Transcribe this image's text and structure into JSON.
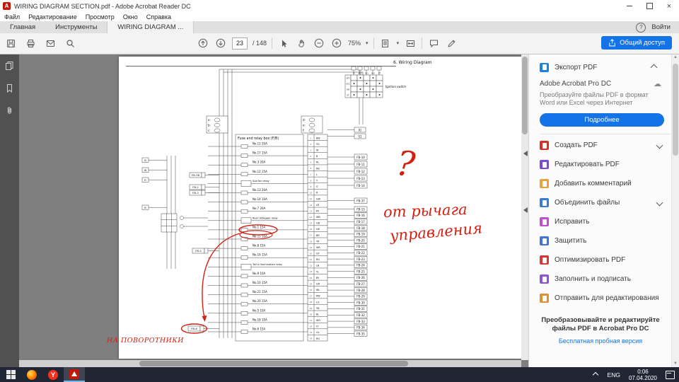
{
  "window": {
    "title": "WIRING DIAGRAM SECTION.pdf - Adobe Acrobat Reader DC"
  },
  "menu": {
    "items": [
      "Файл",
      "Редактирование",
      "Просмотр",
      "Окно",
      "Справка"
    ]
  },
  "tabs": {
    "home": "Главная",
    "tools": "Инструменты",
    "document": "WIRING DIAGRAM ...",
    "help": "?",
    "sign_in": "Войти"
  },
  "toolbar": {
    "page_current": "23",
    "page_total": "/ 148",
    "zoom": "75%",
    "share_label": "Общий доступ"
  },
  "sidebar": {
    "icons": [
      "page-thumbnails-icon",
      "bookmarks-icon",
      "attachments-icon"
    ]
  },
  "document": {
    "diagram": {
      "header": "6. Wiring Diagram",
      "fuse_box_label": "Fuse and relay box (F/B)",
      "ignition_label": "Ignition switch",
      "ignition_cols": [
        "B",
        "ACC",
        "IG1",
        "IG2",
        "ST"
      ],
      "ignition_rows": [
        "OFF",
        "ACC",
        "ON",
        "ST"
      ],
      "fuses": [
        "No.11 20A",
        "No.17 15A",
        "No.3 20A",
        "No.12 15A",
        "Sub fan relay",
        "No.13 20A",
        "No.14 10A",
        "No.7 20A",
        "Rear defogger relay",
        "No.1 15A",
        "No.15 10A",
        "No.8 15A",
        "No.16 15A",
        "Tail & illumination relay",
        "No.9 10A",
        "No.10 15A",
        "No.21 15A",
        "No.20 15A",
        "No.5 10A",
        "No.18 10A",
        "No.6 15A"
      ],
      "left_connectors": [
        "FB-38",
        "FB-2",
        "FB-3",
        "FB-4",
        "FB-6"
      ],
      "right_connectors_top": [
        "FB-10",
        "FB-11",
        "FB-12",
        "FB-13",
        "FB-14"
      ],
      "right_connectors": [
        "FB-37",
        "FB-15",
        "FB-16",
        "FB-17",
        "FB-18",
        "FB-19",
        "FB-20",
        "FB-21",
        "FB-22",
        "FB-23",
        "FB-24",
        "FB-25",
        "FB-26",
        "FB-27",
        "FB-28",
        "FB-29",
        "FB-30",
        "FB-31",
        "FB-32",
        "FB-33",
        "FB-34",
        "FB-35"
      ],
      "top_pins": [
        "IG",
        "S1"
      ],
      "wire_codes": [
        "BW",
        "YG",
        "W",
        "B",
        "RL",
        "RB",
        "L",
        "Y",
        "G",
        "R",
        "GW",
        "LR",
        "RY",
        "WB",
        "GB",
        "LW",
        "BR",
        "YR",
        "WR",
        "GY",
        "RG",
        "LB",
        "YL",
        "BY",
        "GR",
        "WL",
        "RW",
        "LG",
        "YB",
        "BL",
        "WG",
        "LY",
        "GL",
        "RG"
      ],
      "legend_left_rows": [
        "a:",
        "b:",
        "c:"
      ],
      "legend_right_rows": [
        "d:",
        "e:",
        "f:"
      ],
      "left_tiny_labels": [
        "B",
        "W",
        "R",
        "B"
      ],
      "annotations": {
        "question_mark": "?",
        "note_line1": "от рычага",
        "note_line2": "управления",
        "bottom_note": "НА ПОВОРОТНИКИ",
        "color": "#d32011"
      }
    }
  },
  "tools_panel": {
    "export": {
      "title": "Экспорт PDF",
      "icon_color": "#1a82e2",
      "promo_title": "Adobe Acrobat Pro DC",
      "promo_text": "Преобразуйте файлы PDF в формат Word или Excel через Интернет",
      "more_button": "Подробнее"
    },
    "tools": [
      {
        "id": "create-pdf",
        "label": "Создать PDF",
        "color": "#d93025",
        "expandable": true
      },
      {
        "id": "edit-pdf",
        "label": "Редактировать PDF",
        "color": "#7d4ad8"
      },
      {
        "id": "add-comment",
        "label": "Добавить комментарий",
        "color": "#e8a33d"
      },
      {
        "id": "combine-files",
        "label": "Объединить файлы",
        "color": "#3a7bd5",
        "expandable": true
      },
      {
        "id": "fix",
        "label": "Исправить",
        "color": "#c24fcf"
      },
      {
        "id": "protect",
        "label": "Защитить",
        "color": "#3f74d8"
      },
      {
        "id": "optimize-pdf",
        "label": "Оптимизировать PDF",
        "color": "#d93838"
      },
      {
        "id": "fill-sign",
        "label": "Заполнить и подписать",
        "color": "#8a56d6"
      },
      {
        "id": "send-for-review",
        "label": "Отправить для редактирования",
        "color": "#e0912f"
      }
    ],
    "footer_promo": "Преобразовывайте и редактируйте файлы PDF в Acrobat Pro DC",
    "footer_link": "Бесплатная пробная версия"
  },
  "taskbar": {
    "language": "ENG",
    "time": "0:06",
    "date": "07.04.2020"
  }
}
